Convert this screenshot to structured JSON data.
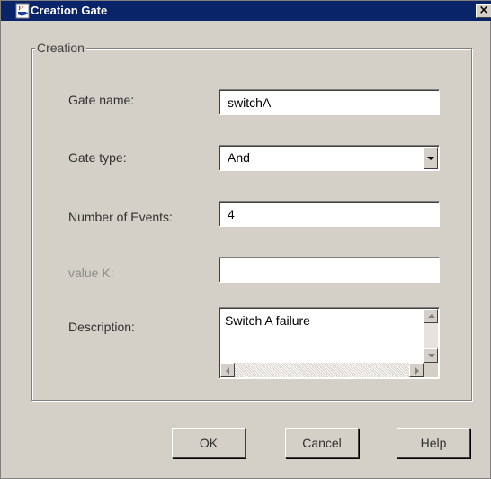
{
  "window": {
    "title": "Creation Gate",
    "close_label": "×"
  },
  "group": {
    "legend": "Creation"
  },
  "form": {
    "gate_name": {
      "label": "Gate name:",
      "value": "switchA"
    },
    "gate_type": {
      "label": "Gate type:",
      "value": "And"
    },
    "num_events": {
      "label": "Number of Events:",
      "value": "4"
    },
    "value_k": {
      "label": "value K:",
      "value": ""
    },
    "description": {
      "label": "Description:",
      "value": "Switch A failure"
    }
  },
  "buttons": {
    "ok": "OK",
    "cancel": "Cancel",
    "help": "Help"
  },
  "colors": {
    "titlebar": "#0a246a",
    "dialog_bg": "#d4d0c8"
  }
}
